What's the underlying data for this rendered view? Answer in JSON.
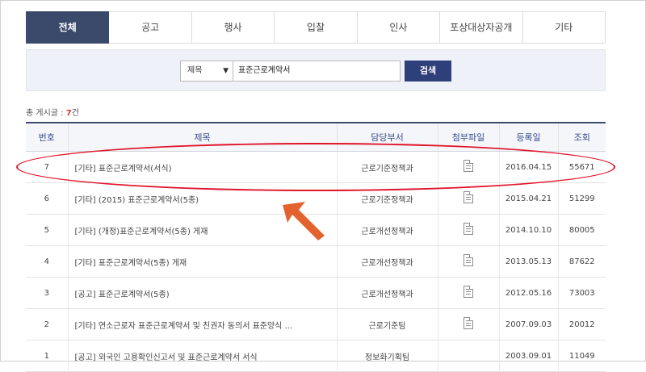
{
  "tabs": [
    "전체",
    "공고",
    "행사",
    "입찰",
    "인사",
    "포상대상자공개",
    "기타"
  ],
  "search": {
    "select_value": "제목",
    "query": "표준근로계약서",
    "button_label": "검색"
  },
  "total": {
    "label": "총 게시글 :",
    "count": "7",
    "unit": "건"
  },
  "table": {
    "headers": [
      "번호",
      "제목",
      "담당부서",
      "첨부파일",
      "등록일",
      "조회"
    ],
    "rows": [
      {
        "no": "7",
        "title": "[기타] 표준근로계약서(서식)",
        "dept": "근로기준정책과",
        "file": true,
        "date": "2016.04.15",
        "views": "55671"
      },
      {
        "no": "6",
        "title": "[기타] (2015) 표준근로계약서(5종)",
        "dept": "근로기준정책과",
        "file": true,
        "date": "2015.04.21",
        "views": "51299"
      },
      {
        "no": "5",
        "title": "[기타] (개정)표준근로계약서(5종) 게재",
        "dept": "근로개선정책과",
        "file": true,
        "date": "2014.10.10",
        "views": "80005"
      },
      {
        "no": "4",
        "title": "[기타] 표준근로계약서(5종) 게재",
        "dept": "근로개선정책과",
        "file": true,
        "date": "2013.05.13",
        "views": "87622"
      },
      {
        "no": "3",
        "title": "[공고] 표준근로계약서(5종)",
        "dept": "근로개선정책과",
        "file": true,
        "date": "2012.05.16",
        "views": "73003"
      },
      {
        "no": "2",
        "title": "[기타] 연소근로자 표준근로계약서 및 친권자 동의서 표준양식 ...",
        "dept": "근로기준팀",
        "file": true,
        "date": "2007.09.03",
        "views": "20012"
      },
      {
        "no": "1",
        "title": "[공고] 외국인 고용확인신고서 및 표준근로계약서 서식",
        "dept": "정보화기획팀",
        "file": false,
        "date": "2003.09.01",
        "views": "11049"
      }
    ]
  },
  "colors": {
    "active_tab": "#3b4a6b",
    "search_button": "#2f3f7a",
    "annotation": "#e0142a",
    "arrow": "#e2632e"
  }
}
